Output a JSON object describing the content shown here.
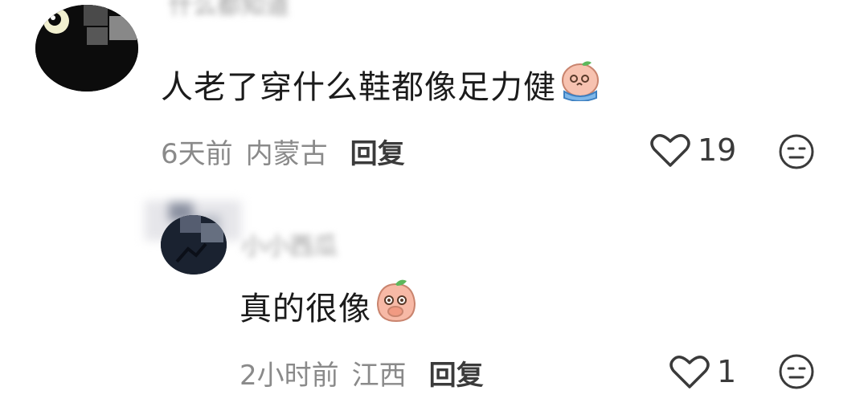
{
  "comments": [
    {
      "username": "什么都知道",
      "text": "人老了穿什么鞋都像足力健",
      "inline_emoji": "crying-peach-emoji",
      "time": "6天前",
      "location": "内蒙古",
      "reply_label": "回复",
      "likes": "19"
    },
    {
      "username": "小小西瓜",
      "text": "真的很像",
      "inline_emoji": "covering-mouth-peach-emoji",
      "time": "2小时前",
      "location": "江西",
      "reply_label": "回复",
      "likes": "1"
    }
  ],
  "icons": {
    "like": "heart-outline-icon",
    "react": "neutral-face-icon"
  },
  "colors": {
    "text": "#1b1b1b",
    "meta": "#8a8a8a",
    "reply": "#3b3b3b",
    "peach": "#f7b9a6"
  }
}
